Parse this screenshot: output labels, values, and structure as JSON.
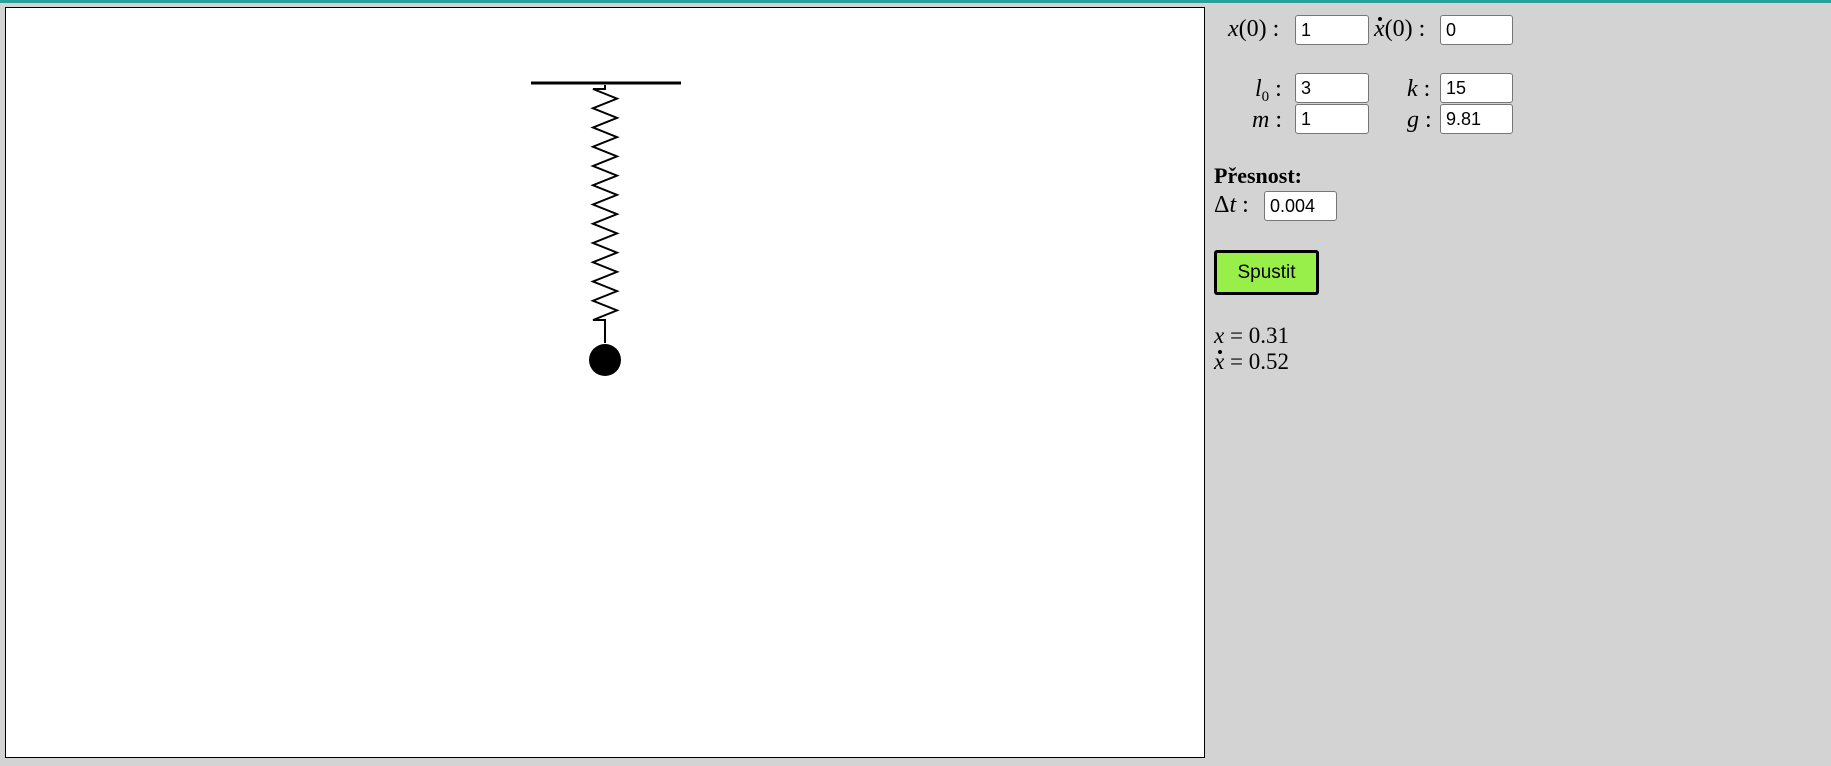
{
  "sim": {
    "params": {
      "x0_label": "x",
      "x0_arg": "(0)",
      "x0_value": "1",
      "v0_label": "x",
      "v0_arg": "(0)",
      "v0_value": "0",
      "l0_label": "l",
      "l0_sub": "0",
      "l0_value": "3",
      "k_label": "k",
      "k_value": "15",
      "m_label": "m",
      "m_value": "1",
      "g_label": "g",
      "g_value": "9.81",
      "colon": ":"
    },
    "precision": {
      "heading": "Přesnost:",
      "dt_symbol": "Δ",
      "dt_var": "t",
      "dt_value": "0.004"
    },
    "run_label": "Spustit",
    "readout": {
      "x_var": "x",
      "x_text": " = 0.31",
      "v_var": "x",
      "v_text": " = 0.52"
    },
    "colors": {
      "run_button": "#99ef4a",
      "background": "#d3d3d3",
      "top_strip": "#2aa198"
    }
  }
}
